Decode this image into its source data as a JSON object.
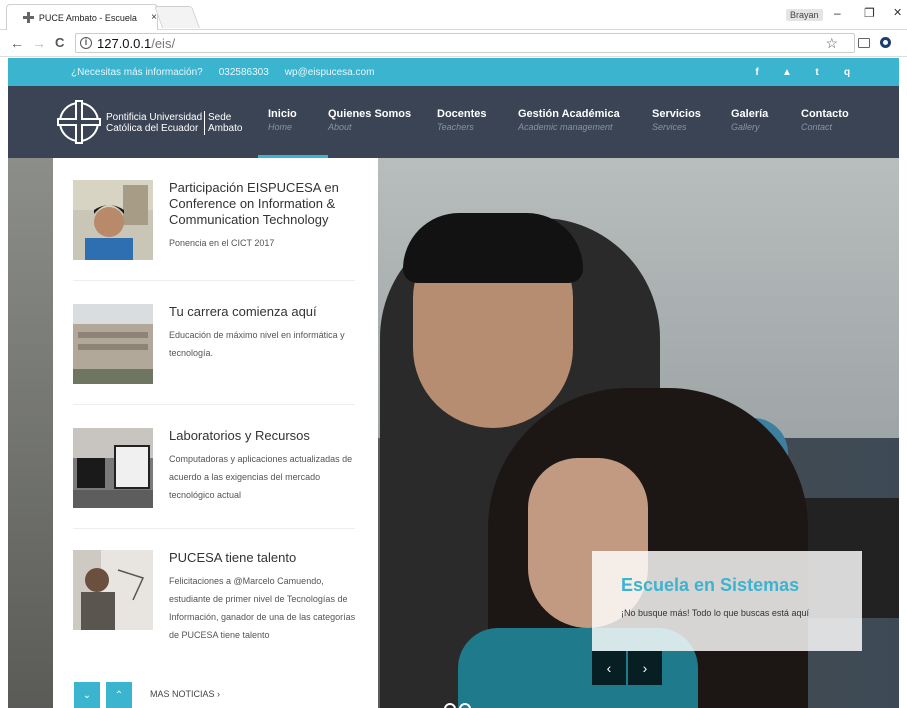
{
  "browser": {
    "tab_title": "PUCE Ambato - Escuela",
    "tab_close": "×",
    "profile": "Brayan",
    "minimize": "–",
    "restore": "❐",
    "close": "✕",
    "back": "←",
    "forward": "→",
    "reload": "C",
    "url_host": "127.0.0.1",
    "url_path": "/eis/",
    "star": "☆"
  },
  "topbar": {
    "links": [
      "¿Necesitas más información?",
      "032586303",
      "wp@eispucesa.com"
    ],
    "social": [
      "f",
      "▲",
      "t",
      "q"
    ]
  },
  "header": {
    "brand_line1": "Pontificia Universidad",
    "brand_line2": "Católica del Ecuador",
    "sede_line1": "Sede",
    "sede_line2": "Ambato",
    "menu": [
      {
        "label": "Inicio",
        "sub": "Home"
      },
      {
        "label": "Quienes Somos",
        "sub": "About"
      },
      {
        "label": "Docentes",
        "sub": "Teachers"
      },
      {
        "label": "Gestión Académica",
        "sub": "Academic management"
      },
      {
        "label": "Servicios",
        "sub": "Services"
      },
      {
        "label": "Galería",
        "sub": "Gallery"
      },
      {
        "label": "Contacto",
        "sub": "Contact"
      }
    ]
  },
  "news": {
    "items": [
      {
        "title": "Participación EISPUCESA en Conference on Information & Communication Technology",
        "desc": "Ponencia en el CICT 2017"
      },
      {
        "title": "Tu carrera comienza aquí",
        "desc": "Educación de máximo nivel en informática y tecnología."
      },
      {
        "title": "Laboratorios y Recursos",
        "desc": "Computadoras y aplicaciones actualizadas de acuerdo a las exigencias del mercado tecnológico actual"
      },
      {
        "title": "PUCESA tiene talento",
        "desc": "Felicitaciones a @Marcelo Camuendo, estudiante de primer nivel de Tecnologías de Información, ganador de una de las categorías de PUCESA tiene talento"
      }
    ],
    "down_btn": "⌄",
    "up_btn": "⌃",
    "more": "MAS NOTICIAS ›"
  },
  "slider": {
    "caption_title": "Escuela en Sistemas",
    "caption_text": "¡No busque más! Todo lo que buscas está aquí",
    "prev": "‹",
    "next": "›"
  },
  "colors": {
    "accent": "#3bb4cf",
    "header_bg": "#3b4454"
  }
}
